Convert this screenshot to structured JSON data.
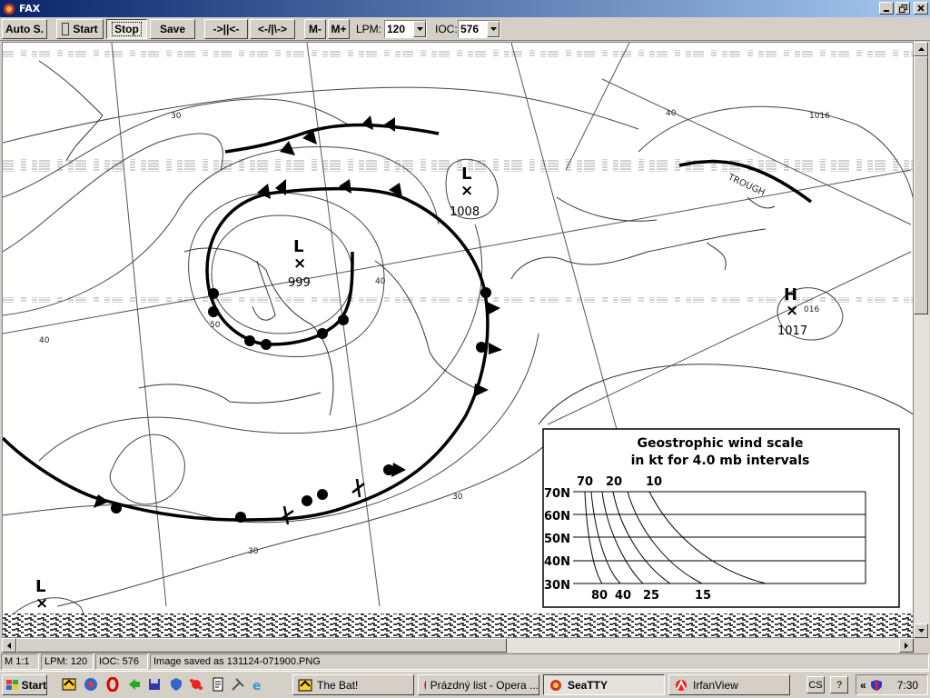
{
  "window": {
    "title": "FAX"
  },
  "toolbar": {
    "auto_label": "Auto S.",
    "start_label": "Start",
    "stop_label": "Stop",
    "save_label": "Save",
    "btn_fwd": "->||<-",
    "btn_back": "<-/|\\->",
    "m_minus": "M-",
    "m_plus": "M+",
    "lpm_label": "LPM:",
    "lpm_value": "120",
    "ioc_label": "IOC:",
    "ioc_value": "576"
  },
  "map": {
    "lows": [
      {
        "letter": "L",
        "pressure": "1008"
      },
      {
        "letter": "L",
        "pressure": "999"
      },
      {
        "letter": "L",
        "pressure": ""
      }
    ],
    "highs": [
      {
        "letter": "H",
        "pressure": "1017"
      }
    ],
    "contour_labels": [
      "30",
      "40",
      "50",
      "1016",
      "016",
      "30",
      "40",
      "40",
      "30"
    ],
    "trough_label": "TROUGH",
    "wind_scale": {
      "title1": "Geostrophic wind scale",
      "title2": "in kt for 4.0 mb intervals",
      "top_values": [
        "70",
        "20",
        "10"
      ],
      "latitudes": [
        "70N",
        "60N",
        "50N",
        "40N",
        "30N"
      ],
      "bottom_values": [
        "80",
        "40",
        "25",
        "15"
      ]
    }
  },
  "status": {
    "mode": "M 1:1",
    "lpm": "LPM: 120",
    "ioc": "IOC: 576",
    "message": "Image saved as 131124-071900.PNG"
  },
  "taskbar": {
    "start_label": "Start",
    "tasks": [
      "The Bat!",
      "Prázdný list - Opera ...",
      "SeaTTY",
      "IrfanView"
    ],
    "lang": "CS",
    "help": "?",
    "time": "7:30"
  }
}
